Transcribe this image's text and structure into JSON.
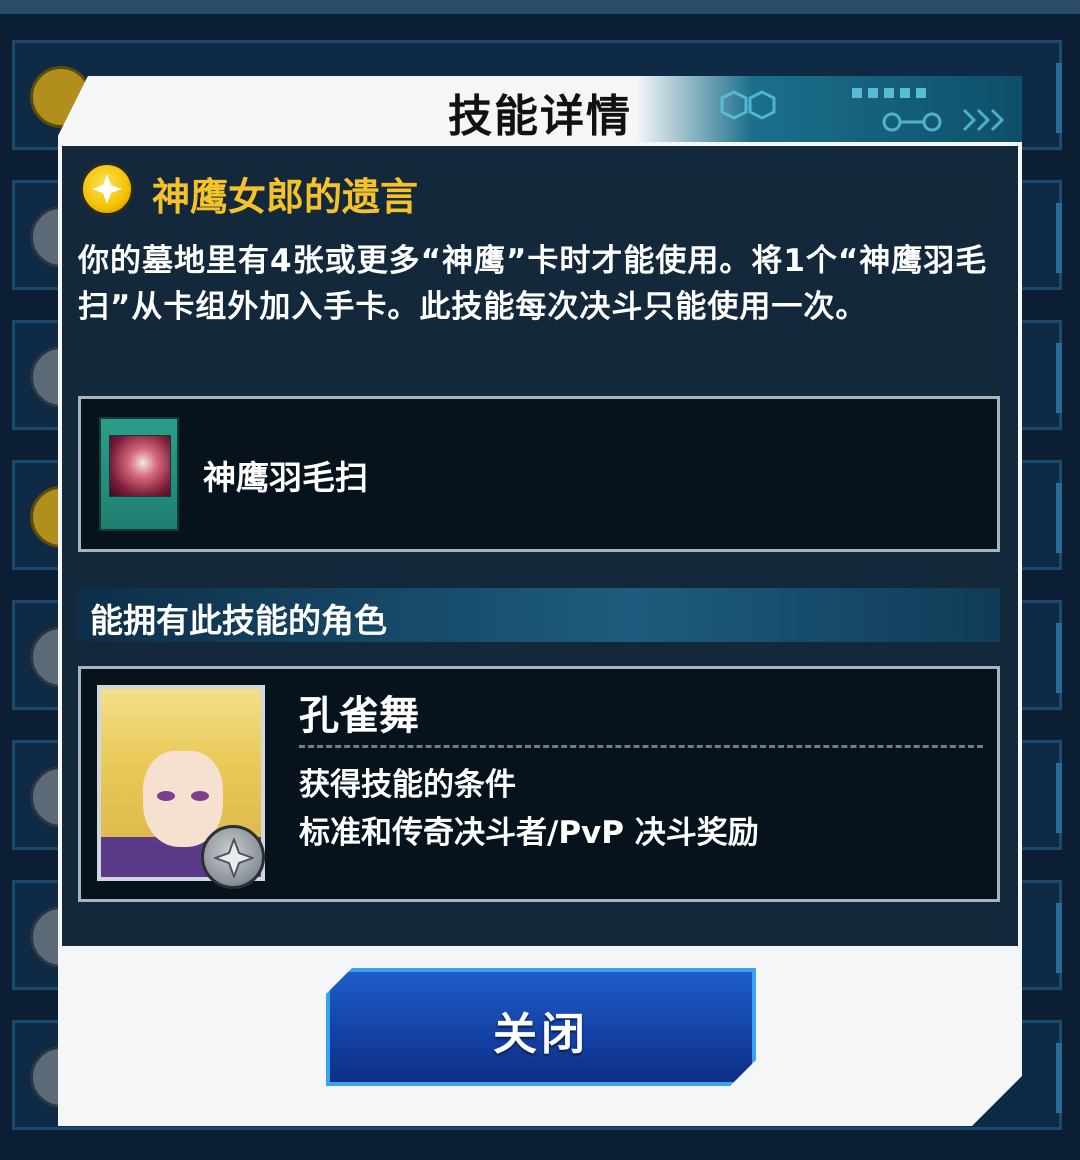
{
  "modal": {
    "title": "技能详情",
    "close_label": "关闭"
  },
  "skill": {
    "name": "神鹰女郎的遗言",
    "icon": "gold-star-skill-icon",
    "description": "你的墓地里有4张或更多“神鹰”卡时才能使用。将1个“神鹰羽毛扫”从卡组外加入手卡。此技能每次决斗只能使用一次。"
  },
  "card": {
    "name": "神鹰羽毛扫"
  },
  "characters_section": {
    "title": "能拥有此技能的角色",
    "character": {
      "name": "孔雀舞",
      "condition_label": "获得技能的条件",
      "condition_value": "标准和传奇决斗者/PvP 决斗奖励"
    }
  },
  "colors": {
    "accent_gold": "#f5c22a",
    "button_blue": "#1442a6",
    "panel_dark": "#13293b"
  }
}
